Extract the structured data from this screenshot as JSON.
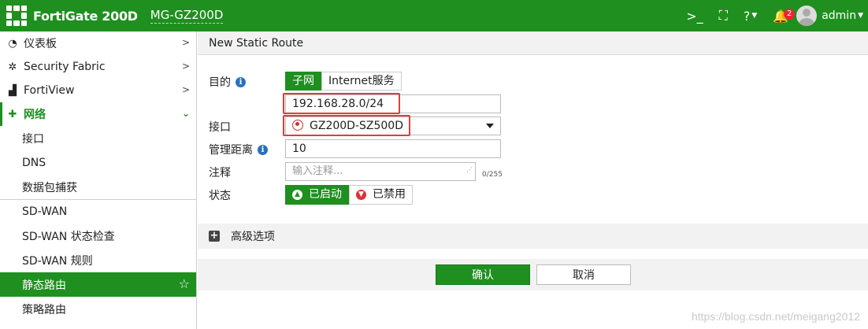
{
  "header": {
    "brand": "FortiGate 200D",
    "hostname": "MG-GZ200D",
    "icons": [
      "cli-icon",
      "fullscreen-icon",
      "help-icon",
      "bell-icon"
    ],
    "notification_count": "2",
    "user": "admin"
  },
  "sidebar": {
    "items": [
      {
        "label": "仪表板",
        "icon": "dashboard-icon"
      },
      {
        "label": "Security Fabric",
        "icon": "fabric-icon"
      },
      {
        "label": "FortiView",
        "icon": "chart-icon"
      },
      {
        "label": "网络",
        "icon": "network-icon"
      }
    ],
    "network_sub": [
      {
        "label": "接口"
      },
      {
        "label": "DNS"
      },
      {
        "label": "数据包捕获"
      },
      {
        "label": "SD-WAN"
      },
      {
        "label": "SD-WAN 状态检查"
      },
      {
        "label": "SD-WAN 规则"
      },
      {
        "label": "静态路由"
      },
      {
        "label": "策略路由"
      }
    ]
  },
  "page": {
    "title": "New Static Route"
  },
  "form": {
    "destination_label": "目的",
    "dest_options": [
      "子网",
      "Internet服务"
    ],
    "subnet_value": "192.168.28.0/24",
    "interface_label": "接口",
    "interface_value": "GZ200D-SZ500D",
    "distance_label": "管理距离",
    "distance_value": "10",
    "comment_label": "注释",
    "comment_placeholder": "输入注释...",
    "comment_counter": "0/255",
    "status_label": "状态",
    "status_enabled": "已启动",
    "status_disabled": "已禁用",
    "advanced_label": "高级选项"
  },
  "footer": {
    "ok_label": "确认",
    "cancel_label": "取消"
  },
  "watermark": "https://blog.csdn.net/meigang2012",
  "colors": {
    "brand_green": "#1f8f1f",
    "highlight_red": "#d9403b"
  }
}
